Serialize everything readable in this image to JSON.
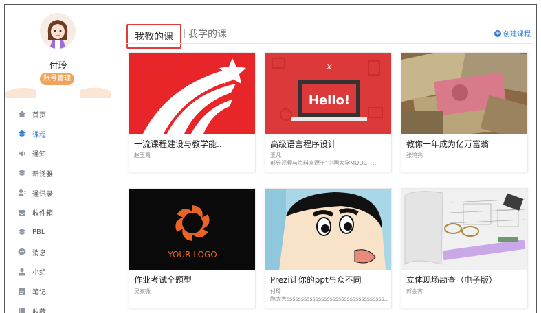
{
  "profile": {
    "name": "付玲",
    "manage_label": "账号管理"
  },
  "nav": [
    {
      "label": "首页",
      "icon": "home-icon",
      "active": false
    },
    {
      "label": "课程",
      "icon": "course-icon",
      "active": true
    },
    {
      "label": "通知",
      "icon": "notice-icon",
      "active": false
    },
    {
      "label": "新泛雅",
      "icon": "fanya-icon",
      "active": false
    },
    {
      "label": "通讯录",
      "icon": "contacts-icon",
      "active": false
    },
    {
      "label": "收件箱",
      "icon": "inbox-icon",
      "active": false
    },
    {
      "label": "PBL",
      "icon": "pbl-icon",
      "active": false
    },
    {
      "label": "消息",
      "icon": "message-icon",
      "active": false
    },
    {
      "label": "小组",
      "icon": "group-icon",
      "active": false
    },
    {
      "label": "笔记",
      "icon": "note-icon",
      "active": false
    },
    {
      "label": "收藏",
      "icon": "favorite-icon",
      "active": false
    }
  ],
  "tabs": {
    "active": "我教的课",
    "other": "我学的课"
  },
  "create_label": "创建课程",
  "courses": [
    {
      "title": "一流课程建设与教学能...",
      "teacher": "赵玉霞",
      "note": ""
    },
    {
      "title": "高级语言程序设计",
      "teacher": "王凡",
      "note": "部分视频与资料来源于“中国大学MOOC—..."
    },
    {
      "title": "教你一年成为亿万富翁",
      "teacher": "张鸿亮",
      "note": ""
    },
    {
      "title": "作业考试全题型",
      "teacher": "吴案微",
      "note": ""
    },
    {
      "title": "Prezi让你的ppt与众不同",
      "teacher": "付玲",
      "note": "鹏大大ssssssssssssssssssssssssssssssssss..."
    },
    {
      "title": "立体现场勘查（电子版）",
      "teacher": "郭金宵",
      "note": ""
    }
  ],
  "thumb_text": {
    "hello": "Hello!",
    "logo": "YOUR LOGO",
    "x_mark": "x"
  },
  "colors": {
    "accent": "#2f7bd8",
    "highlight": "#e23b3b",
    "manage": "#f0a35a"
  }
}
